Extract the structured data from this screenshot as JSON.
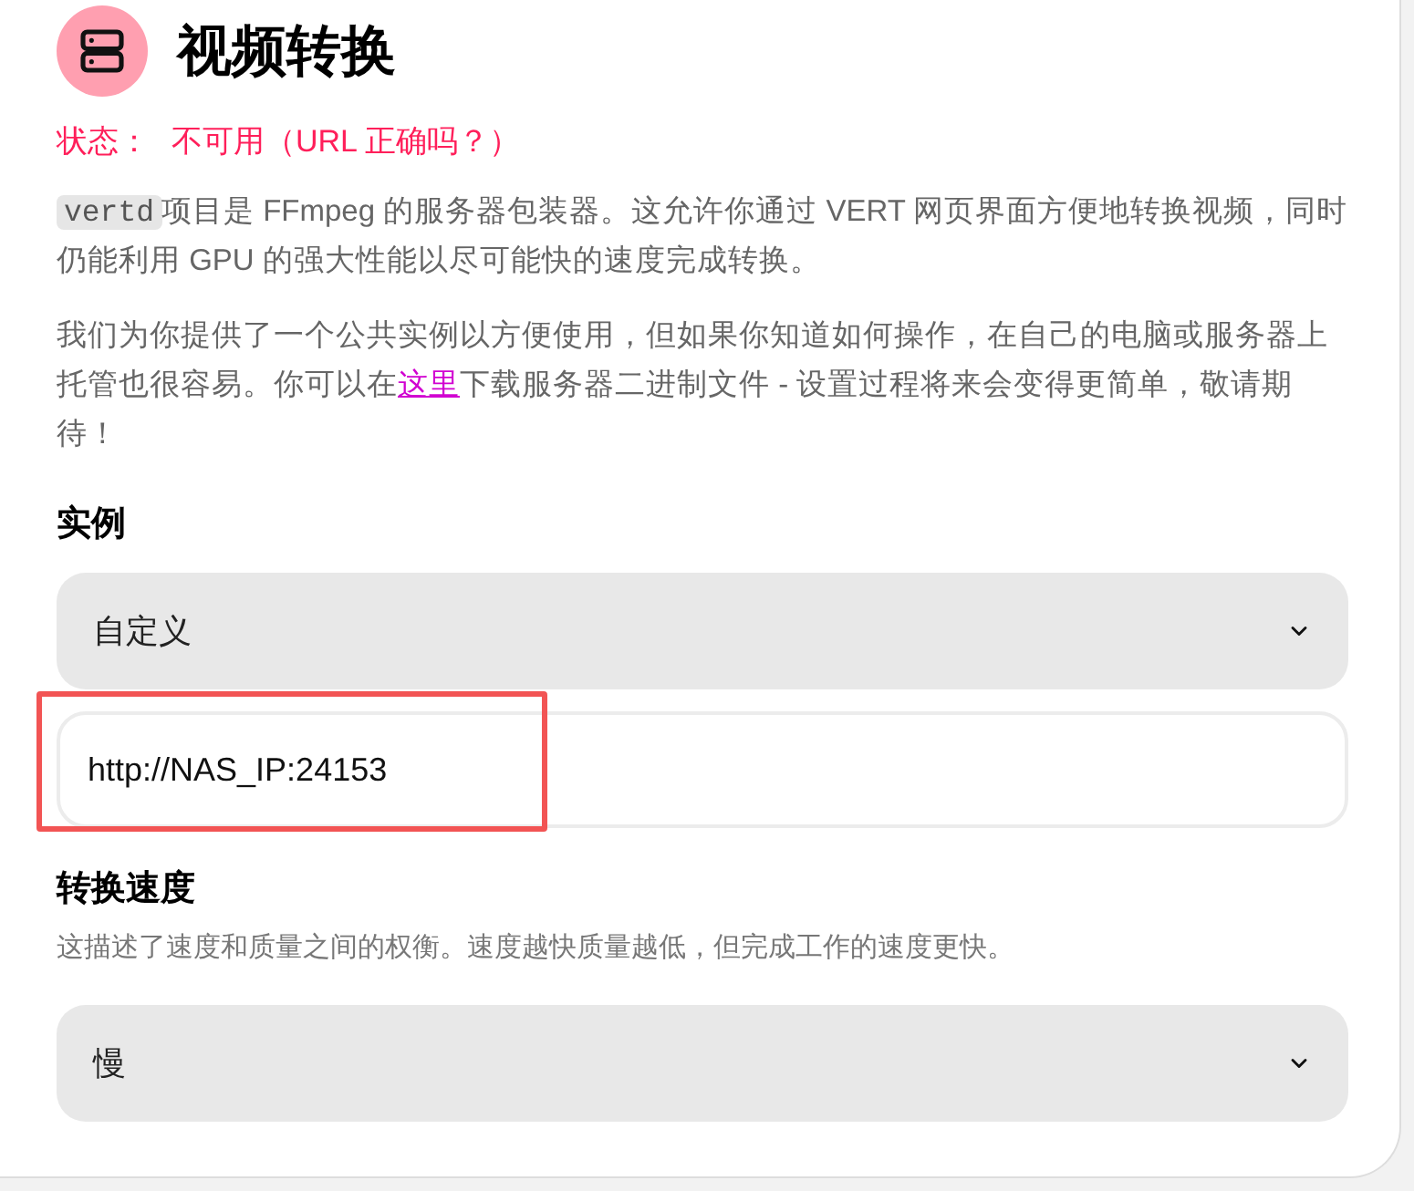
{
  "header": {
    "title": "视频转换"
  },
  "status": {
    "label": "状态：",
    "value": "不可用（URL 正确吗？）"
  },
  "description": {
    "code": "vertd",
    "text": "项目是 FFmpeg 的服务器包装器。这允许你通过 VERT 网页界面方便地转换视频，同时仍能利用 GPU 的强大性能以尽可能快的速度完成转换。"
  },
  "hosting": {
    "before": "我们为你提供了一个公共实例以方便使用，但如果你知道如何操作，在自己的电脑或服务器上托管也很容易。你可以在",
    "link": "这里",
    "after": "下载服务器二进制文件 - 设置过程将来会变得更简单，敬请期待！"
  },
  "instance": {
    "heading": "实例",
    "select_value": "自定义",
    "url_value": "http://NAS_IP:24153",
    "highlighted": true
  },
  "speed": {
    "heading": "转换速度",
    "hint": "这描述了速度和质量之间的权衡。速度越快质量越低，但完成工作的速度更快。",
    "select_value": "慢"
  }
}
